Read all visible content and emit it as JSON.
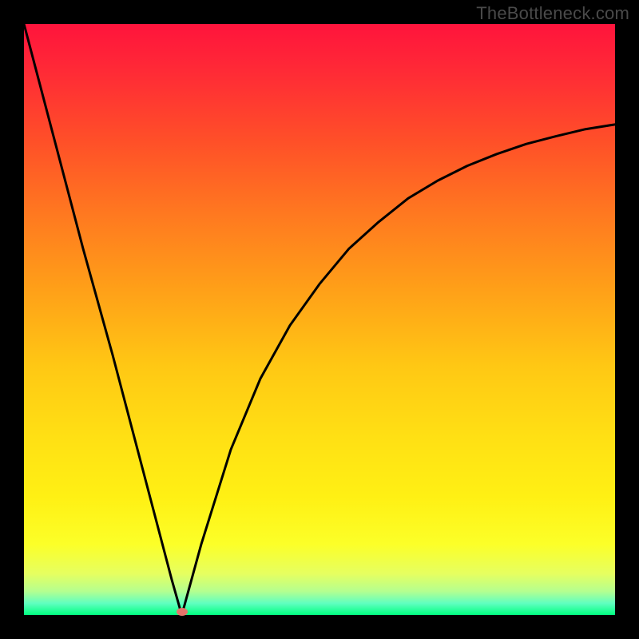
{
  "watermark": "TheBottleneck.com",
  "chart_data": {
    "type": "line",
    "title": "",
    "xlabel": "",
    "ylabel": "",
    "xlim": [
      0,
      100
    ],
    "ylim": [
      0,
      100
    ],
    "grid": false,
    "legend": false,
    "series": [
      {
        "name": "left-segment",
        "x": [
          0,
          5,
          10,
          15,
          20,
          25,
          26.7
        ],
        "values": [
          100,
          81,
          62,
          44,
          25,
          6,
          0
        ]
      },
      {
        "name": "right-segment",
        "x": [
          26.7,
          30,
          35,
          40,
          45,
          50,
          55,
          60,
          65,
          70,
          75,
          80,
          85,
          90,
          95,
          100
        ],
        "values": [
          0,
          12,
          28,
          40,
          49,
          56,
          62,
          66.5,
          70.5,
          73.5,
          76,
          78,
          79.7,
          81,
          82.2,
          83
        ]
      }
    ],
    "marker": {
      "x": 26.7,
      "y": 0.5,
      "color": "#e5736b"
    },
    "gradient_colors": {
      "top": "#ff143c",
      "mid": "#ffe014",
      "bottom": "#00ff7f"
    },
    "curve_color": "#000000"
  }
}
